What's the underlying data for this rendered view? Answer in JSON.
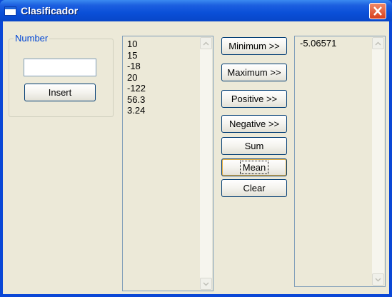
{
  "window": {
    "title": "Clasificador"
  },
  "number_group": {
    "legend": "Number",
    "input_value": "",
    "insert_label": "Insert"
  },
  "numbers_list": [
    "10",
    "15",
    "-18",
    "20",
    "-122",
    "56.3",
    "3.24"
  ],
  "actions": {
    "minimum": "Minimum >>",
    "maximum": "Maximum >>",
    "positive": "Positive >>",
    "negative": "Negative >>",
    "sum": "Sum",
    "mean": "Mean",
    "clear": "Clear"
  },
  "results_list": [
    "-5.06571"
  ],
  "icons": {
    "window": "window-icon",
    "close": "close-icon",
    "scroll_up": "arrow-up-icon",
    "scroll_down": "arrow-down-icon"
  },
  "colors": {
    "titlebar": "#0a4fd8",
    "close_button": "#d8401c",
    "legend_text": "#0046d5",
    "client_bg": "#ece9d8"
  }
}
